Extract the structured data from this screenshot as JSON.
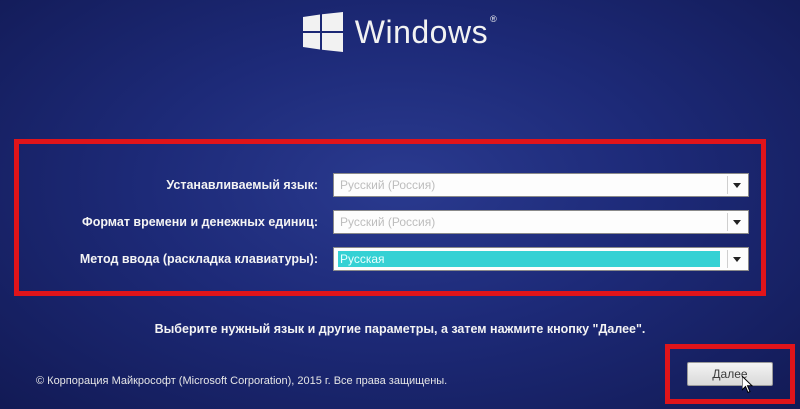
{
  "header": {
    "brand": "Windows",
    "trademark": "®",
    "logo_icon": "windows-logo-icon"
  },
  "form": {
    "language_label": "Устанавливаемый язык:",
    "language_value": "Русский (Россия)",
    "format_label": "Формат времени и денежных единиц:",
    "format_value": "Русский (Россия)",
    "keyboard_label": "Метод ввода (раскладка клавиатуры):",
    "keyboard_value": "Русская",
    "dropdown_icon": "chevron-down-icon"
  },
  "hint": "Выберите нужный язык и другие параметры, а затем нажмите кнопку \"Далее\".",
  "footer": {
    "copyright": "© Корпорация Майкрософт (Microsoft Corporation), 2015 г. Все права защищены.",
    "next_label": "Далее"
  },
  "colors": {
    "background": "#1d2a78",
    "highlight": "#e0141a",
    "selection": "#35d1d4"
  }
}
